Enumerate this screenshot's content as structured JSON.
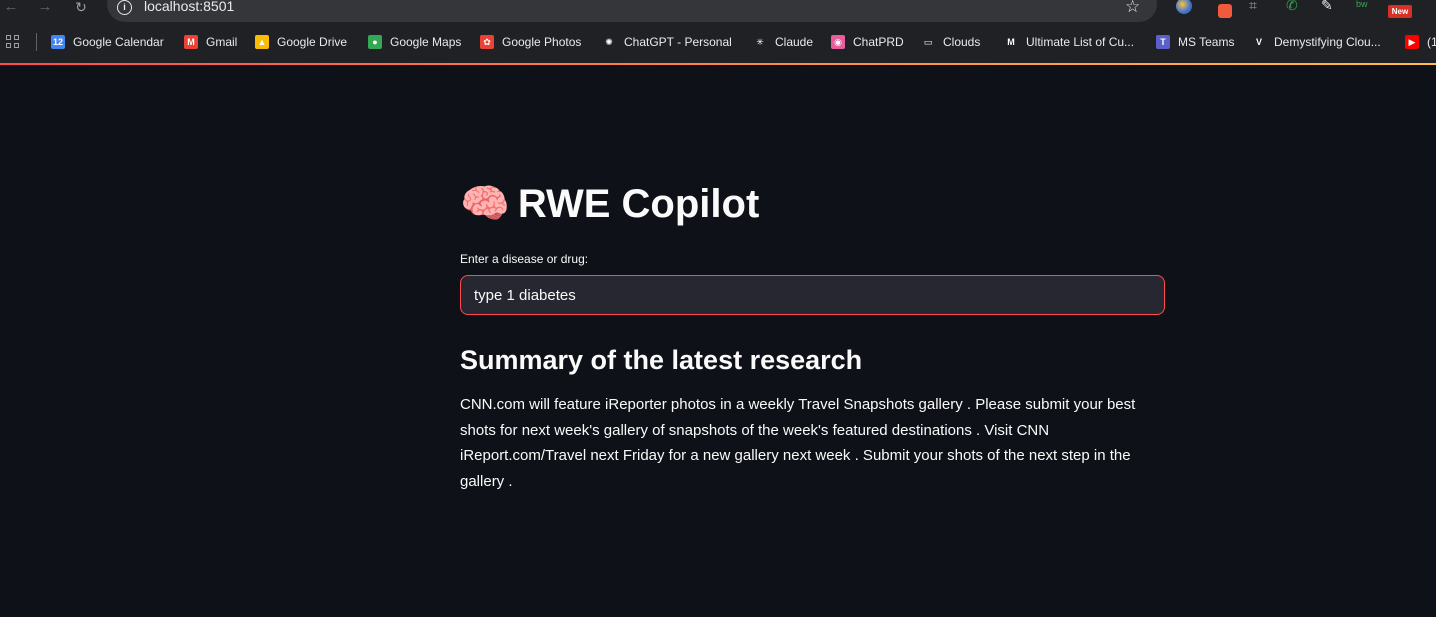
{
  "browser": {
    "url": "localhost:8501",
    "extension_badge": "New",
    "extension_mini_label": "bw",
    "bookmarks": [
      {
        "label": "Google Calendar",
        "icon": "calendar-icon",
        "color": "#4285f4",
        "glyph": "12"
      },
      {
        "label": "Gmail",
        "icon": "gmail-icon",
        "color": "#ea4335",
        "glyph": "M"
      },
      {
        "label": "Google Drive",
        "icon": "drive-icon",
        "color": "#fbbc04",
        "glyph": "▲"
      },
      {
        "label": "Google Maps",
        "icon": "maps-icon",
        "color": "#34a853",
        "glyph": "●"
      },
      {
        "label": "Google Photos",
        "icon": "photos-icon",
        "color": "#ea4335",
        "glyph": "✿"
      },
      {
        "label": "ChatGPT - Personal",
        "icon": "chatgpt-icon",
        "color": "#202124",
        "glyph": "✺"
      },
      {
        "label": "Claude",
        "icon": "claude-icon",
        "color": "#202124",
        "glyph": "✳"
      },
      {
        "label": "ChatPRD",
        "icon": "chatprd-icon",
        "color": "#e85d9b",
        "glyph": "◉"
      },
      {
        "label": "Clouds",
        "icon": "folder-icon",
        "color": "#202124",
        "glyph": "▭"
      },
      {
        "label": "Ultimate List of Cu...",
        "icon": "medium-icon",
        "color": "#202124",
        "glyph": "M"
      },
      {
        "label": "MS Teams",
        "icon": "teams-icon",
        "color": "#5b5fc7",
        "glyph": "T"
      },
      {
        "label": "Demystifying Clou...",
        "icon": "v-icon",
        "color": "#202124",
        "glyph": "V"
      },
      {
        "label": "(1",
        "icon": "youtube-icon",
        "color": "#ff0000",
        "glyph": "▶"
      }
    ]
  },
  "app": {
    "title_icon": "🧠",
    "title": "RWE Copilot",
    "input_label": "Enter a disease or drug:",
    "input_value": "type 1 diabetes",
    "summary_heading": "Summary of the latest research",
    "summary_text": "CNN.com will feature iReporter photos in a weekly Travel Snapshots gallery . Please submit your best shots for next week's gallery of snapshots of the week's featured destinations . Visit CNN iReport.com/Travel next Friday for a new gallery next week . Submit your shots of the next step in the gallery ."
  },
  "colors": {
    "background": "#0e1117",
    "input_border_focus": "#ff4b4b",
    "input_bg": "#262730",
    "text": "#fafafa"
  }
}
